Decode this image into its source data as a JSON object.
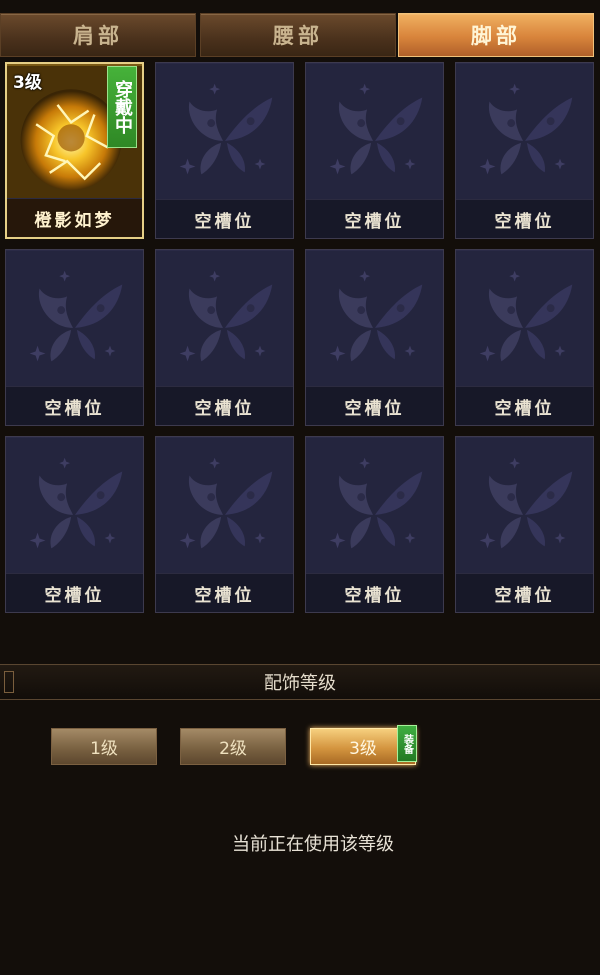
{
  "tabs": [
    {
      "label": "肩部",
      "active": false
    },
    {
      "label": "腰部",
      "active": false
    },
    {
      "label": "脚部",
      "active": true
    }
  ],
  "slots": [
    {
      "name": "橙影如梦",
      "equipped": true,
      "level": "3级",
      "badge": "穿戴中"
    },
    {
      "name": "空槽位"
    },
    {
      "name": "空槽位"
    },
    {
      "name": "空槽位"
    },
    {
      "name": "空槽位"
    },
    {
      "name": "空槽位"
    },
    {
      "name": "空槽位"
    },
    {
      "name": "空槽位"
    },
    {
      "name": "空槽位"
    },
    {
      "name": "空槽位"
    },
    {
      "name": "空槽位"
    },
    {
      "name": "空槽位"
    }
  ],
  "accessory_level": {
    "title": "配饰等级",
    "levels": [
      {
        "label": "1级",
        "selected": false
      },
      {
        "label": "2级",
        "selected": false
      },
      {
        "label": "3级",
        "selected": true
      }
    ],
    "equip_tag": "装备",
    "status": "当前正在使用该等级"
  },
  "colors": {
    "active_tab": "#d8843b",
    "equipped_badge": "#2f8825",
    "empty_slot": "#1c1d33"
  }
}
